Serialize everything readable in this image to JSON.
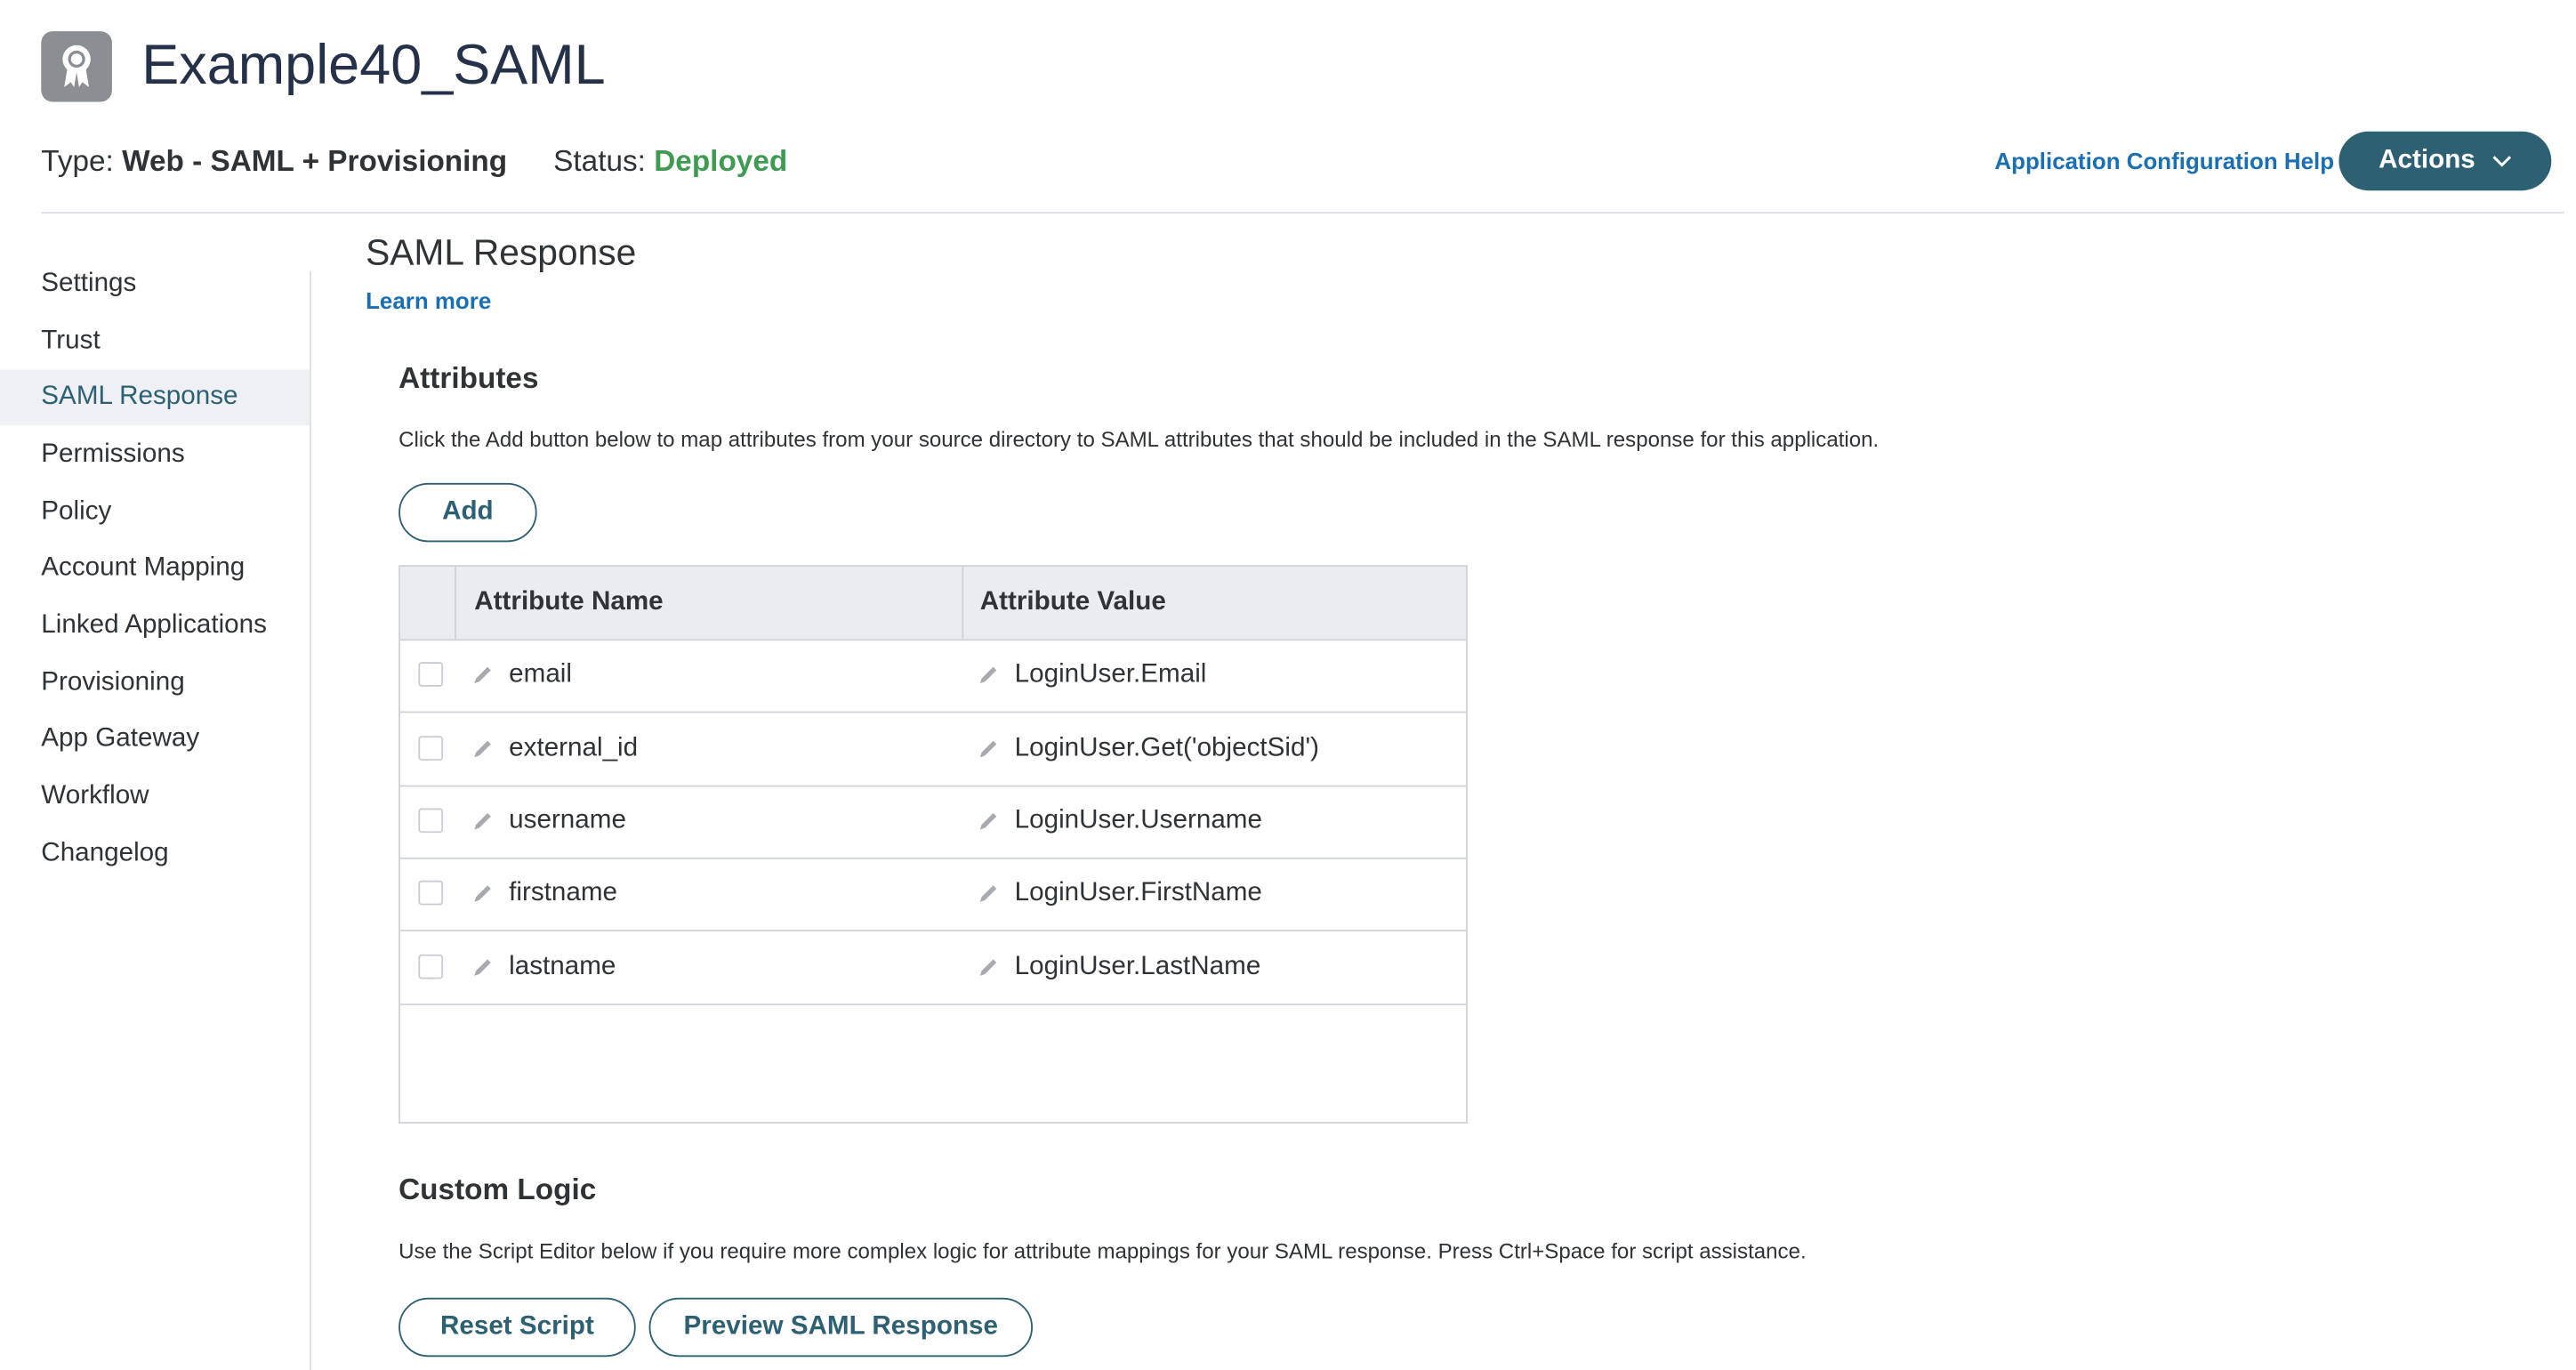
{
  "header": {
    "app_icon": "certificate-ribbon-icon",
    "title": "Example40_SAML",
    "type_label": "Type:",
    "type_value": "Web - SAML + Provisioning",
    "status_label": "Status:",
    "status_value": "Deployed",
    "help_link": "Application Configuration Help",
    "actions_label": "Actions"
  },
  "sidebar": {
    "items": [
      {
        "label": "Settings"
      },
      {
        "label": "Trust"
      },
      {
        "label": "SAML Response"
      },
      {
        "label": "Permissions"
      },
      {
        "label": "Policy"
      },
      {
        "label": "Account Mapping"
      },
      {
        "label": "Linked Applications"
      },
      {
        "label": "Provisioning"
      },
      {
        "label": "App Gateway"
      },
      {
        "label": "Workflow"
      },
      {
        "label": "Changelog"
      }
    ],
    "active": "SAML Response"
  },
  "main": {
    "title": "SAML Response",
    "learn_more": "Learn more",
    "attributes": {
      "heading": "Attributes",
      "description": "Click the Add button below to map attributes from your source directory to SAML attributes that should be included in the SAML response for this application.",
      "add_label": "Add",
      "columns": [
        "Attribute Name",
        "Attribute Value"
      ],
      "rows": [
        {
          "name": "email",
          "value": "LoginUser.Email"
        },
        {
          "name": "external_id",
          "value": "LoginUser.Get('objectSid')"
        },
        {
          "name": "username",
          "value": "LoginUser.Username"
        },
        {
          "name": "firstname",
          "value": "LoginUser.FirstName"
        },
        {
          "name": "lastname",
          "value": "LoginUser.LastName"
        }
      ]
    },
    "custom_logic": {
      "heading": "Custom Logic",
      "description": "Use the Script Editor below if you require more complex logic for attribute mappings for your SAML response. Press Ctrl+Space for script assistance.",
      "reset_label": "Reset Script",
      "preview_label": "Preview SAML Response"
    }
  },
  "colors": {
    "accent": "#2d6073",
    "link": "#1a6fb3",
    "status_ok": "#3f9a52",
    "title": "#253149"
  }
}
